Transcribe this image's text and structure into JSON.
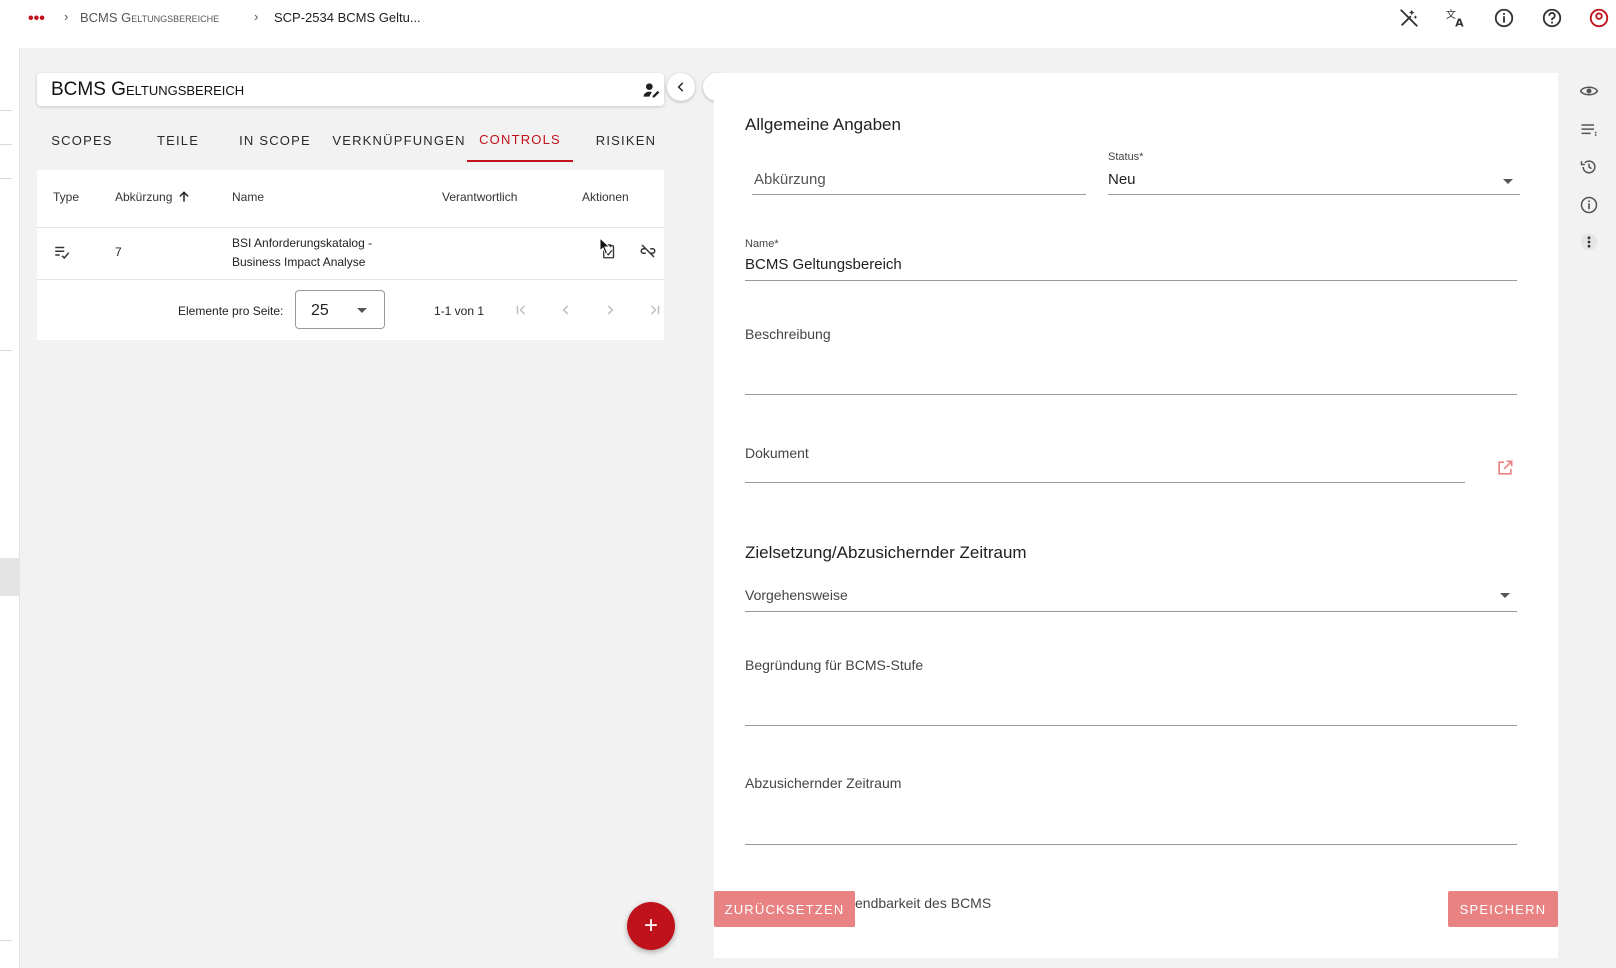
{
  "breadcrumb": {
    "menu": "•••",
    "sep1": "›",
    "item1": "BCMS Geltungsbereiche",
    "sep2": "›",
    "item2": "SCP-2534 BCMS Geltu..."
  },
  "topbar_icons": [
    "wand-off-icon",
    "translate-icon",
    "info-icon",
    "help-icon",
    "account-icon"
  ],
  "left_panel": {
    "title": "BCMS Geltungsbereich",
    "tabs": [
      {
        "label": "SCOPES"
      },
      {
        "label": "TEILE"
      },
      {
        "label": "IN SCOPE"
      },
      {
        "label": "VERKNÜPFUNGEN"
      },
      {
        "label": "CONTROLS"
      },
      {
        "label": "RISIKEN"
      }
    ],
    "active_tab": "CONTROLS",
    "table": {
      "columns": [
        "Type",
        "Abkürzung",
        "Name",
        "Verantwortlich",
        "Aktionen"
      ],
      "sorted_column": "Abkürzung",
      "rows": [
        {
          "type_icon": "checklist-icon",
          "abkuerzung": "7",
          "name_line1": "BSI Anforderungskatalog -",
          "name_line2": "Business Impact Analyse",
          "verantwortlich": ""
        }
      ]
    },
    "pager": {
      "per_page_label": "Elemente pro Seite:",
      "per_page_value": "25",
      "range": "1-1 von 1"
    },
    "fab_label": "+"
  },
  "form": {
    "section1": "Allgemeine Angaben",
    "abkuerzung_placeholder": "Abkürzung",
    "status_label": "Status*",
    "status_value": "Neu",
    "name_label": "Name*",
    "name_value": "BCMS Geltungsbereich",
    "beschreibung_label": "Beschreibung",
    "dokument_label": "Dokument",
    "section2": "Zielsetzung/Abzusichernder Zeitraum",
    "vorgehensweise_label": "Vorgehensweise",
    "begruendung_label": "Begründung für BCMS-Stufe",
    "zeitraum_label": "Abzusichernder Zeitraum",
    "partial_label": "endbarkeit des BCMS",
    "reset_label": "ZURÜCKSETZEN",
    "save_label": "SPEICHERN"
  },
  "colors": {
    "accent": "#c0121a",
    "button_disabled": "#e98383"
  }
}
